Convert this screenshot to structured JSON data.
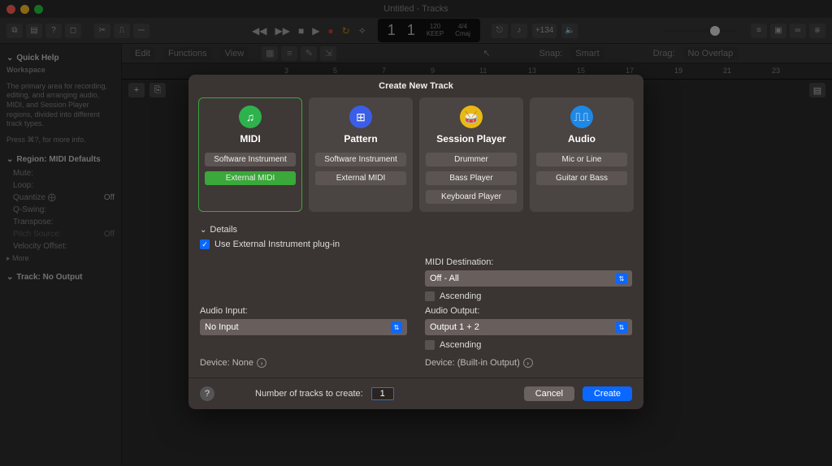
{
  "window": {
    "title": "Untitled - Tracks"
  },
  "lcd": {
    "bars": "1",
    "beats": "1",
    "tempo": "120",
    "keep": "KEEP",
    "sig": "4/4",
    "key": "Cmaj",
    "cpu": "+134"
  },
  "toolbar_menus": {
    "edit": "Edit",
    "functions": "Functions",
    "view": "View",
    "snap_label": "Snap:",
    "snap_value": "Smart",
    "drag_label": "Drag:",
    "drag_value": "No Overlap"
  },
  "ruler": [
    "3",
    "5",
    "7",
    "9",
    "11",
    "13",
    "15",
    "17",
    "19",
    "21",
    "23"
  ],
  "sidebar": {
    "quick_help": {
      "heading": "Quick Help",
      "title": "Workspace",
      "body": "The primary area for recording, editing, and arranging audio, MIDI, and Session Player regions, divided into different track types.",
      "press": "Press ⌘?, for more info."
    },
    "region": {
      "heading": "Region: MIDI Defaults",
      "rows": [
        {
          "label": "Mute:",
          "value": ""
        },
        {
          "label": "Loop:",
          "value": ""
        },
        {
          "label": "Quantize ⨁",
          "value": "Off"
        },
        {
          "label": "Q-Swing:",
          "value": ""
        },
        {
          "label": "Transpose:",
          "value": ""
        },
        {
          "label": "Pitch Source:",
          "value": "Off"
        },
        {
          "label": "Velocity Offset:",
          "value": ""
        }
      ],
      "more": "More"
    },
    "track": {
      "heading": "Track: No Output"
    }
  },
  "dialog": {
    "title": "Create New Track",
    "types": [
      {
        "name": "MIDI",
        "icon": "♫",
        "color": "green",
        "buttons": [
          "Software Instrument",
          "External MIDI"
        ],
        "active_index": 1,
        "selected": true
      },
      {
        "name": "Pattern",
        "icon": "⊞",
        "color": "blue",
        "buttons": [
          "Software Instrument",
          "External MIDI"
        ]
      },
      {
        "name": "Session Player",
        "icon": "🥁",
        "color": "yellow",
        "buttons": [
          "Drummer",
          "Bass Player",
          "Keyboard Player"
        ]
      },
      {
        "name": "Audio",
        "icon": "▮▮▮",
        "color": "lblue",
        "buttons": [
          "Mic or Line",
          "Guitar or Bass"
        ]
      }
    ],
    "details_label": "Details",
    "use_external": "Use External Instrument plug-in",
    "midi_dest_label": "MIDI Destination:",
    "midi_dest_value": "Off - All",
    "ascending1": "Ascending",
    "audio_input_label": "Audio Input:",
    "audio_input_value": "No Input",
    "audio_output_label": "Audio Output:",
    "audio_output_value": "Output 1 + 2",
    "ascending2": "Ascending",
    "device_none": "Device: None",
    "device_builtin": "Device: (Built-in Output)",
    "num_tracks_label": "Number of tracks to create:",
    "num_tracks_value": "1",
    "cancel": "Cancel",
    "create": "Create"
  }
}
